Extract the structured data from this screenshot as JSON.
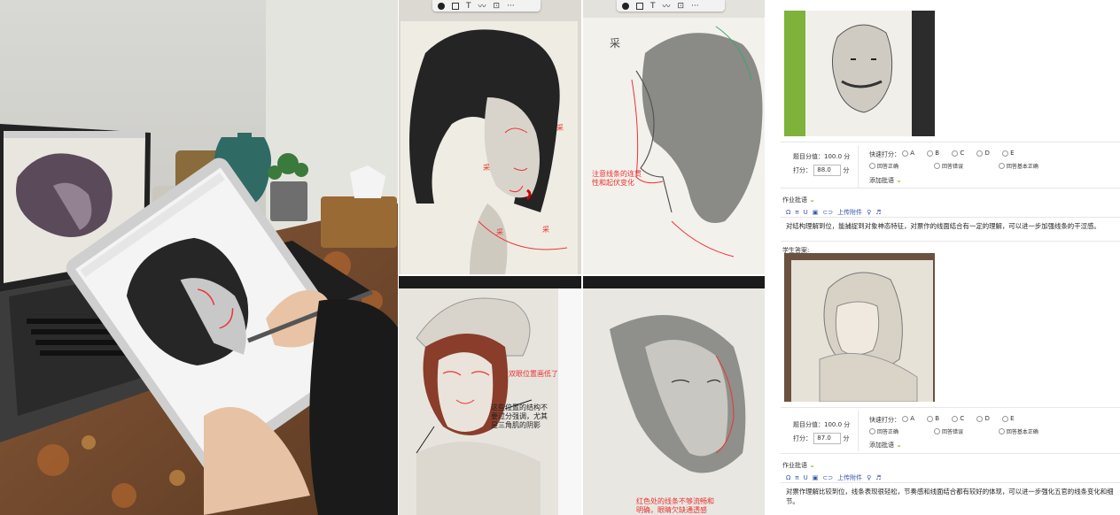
{
  "toolbar_icons": [
    "avatar-icon",
    "square-icon",
    "text-icon",
    "wave-icon",
    "camera-icon",
    "more-icon"
  ],
  "toolbar_text": {
    "text": "T",
    "more": "···"
  },
  "sketch_tl": {
    "annos": [
      "采",
      "采",
      "采",
      "采"
    ]
  },
  "sketch_tr": {
    "label": "采",
    "note": "注意线条的连贯\n性和起伏变化"
  },
  "sketch_bl": {
    "note1": "双眼位置画低了",
    "note2": "这些位置的结构不\n要过分强调，尤其\n是三角肌的阴影"
  },
  "sketch_br": {
    "note": "红色处的线条不够流畅和\n明确，眼睛欠缺通透感"
  },
  "grading": [
    {
      "score_label": "题目分值：100.0 分",
      "input_label": "打分：",
      "input_value": "88.0",
      "unit": "分",
      "quick_label": "快速打分：",
      "options": [
        "A",
        "B",
        "C",
        "D",
        "E"
      ],
      "answers": [
        "回答正确",
        "回答错误",
        "回答基本正确"
      ],
      "add_comment": "添加批语",
      "section_label": "作业批语",
      "comment": "对结构理解到位，能捕捉到对象神态特征，对票作的线面结合有一定的理解，可以进一步加强线条的干涩感。"
    },
    {
      "score_label": "题目分值：100.0 分",
      "input_label": "打分：",
      "input_value": "87.0",
      "unit": "分",
      "quick_label": "快速打分：",
      "options": [
        "A",
        "B",
        "C",
        "D",
        "E"
      ],
      "answers": [
        "回答正确",
        "回答错误",
        "回答基本正确"
      ],
      "add_comment": "添加批语",
      "section_label": "作业批语",
      "comment": "对票作理解比较到位，线条表现很轻松，节奏感和线面结合都有较好的体现，可以进一步强化五官的线条变化和细节。"
    }
  ],
  "student_answer_label": "学生答案:",
  "editor_tools": {
    "upload": "上传附件"
  }
}
